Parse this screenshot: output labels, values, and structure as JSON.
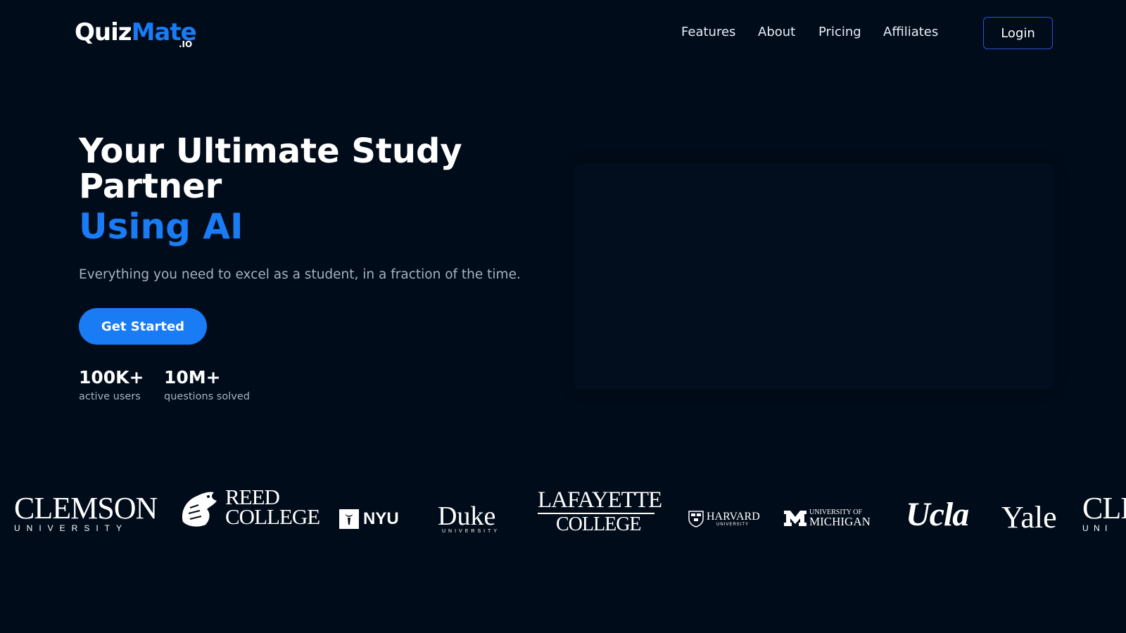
{
  "nav": {
    "logo_main": "Quiz",
    "logo_accent": "Mate",
    "logo_suffix": ".IO",
    "links": [
      "Features",
      "About",
      "Pricing",
      "Affiliates"
    ],
    "login_label": "Login"
  },
  "hero": {
    "title": "Your Ultimate Study Partner",
    "accent": "Using AI",
    "subtitle": "Everything you need to excel as a student, in a fraction of the time.",
    "cta_label": "Get Started",
    "stats": [
      {
        "value": "100K+",
        "label": "active users"
      },
      {
        "value": "10M+",
        "label": "questions solved"
      }
    ]
  },
  "universities": {
    "clemson": {
      "name": "CLEMSON",
      "sub": "UNIVERSITY"
    },
    "reed": {
      "line1": "REED",
      "line2": "COLLEGE"
    },
    "nyu": {
      "name": "NYU"
    },
    "duke": {
      "name": "Duke",
      "sub": "UNIVERSITY"
    },
    "lafayette": {
      "line1": "LAFAYETTE",
      "line2": "COLLEGE"
    },
    "harvard": {
      "name": "HARVARD",
      "sub": "UNIVERSITY"
    },
    "michigan": {
      "line1": "UNIVERSITY OF",
      "line2": "MICHIGAN"
    },
    "ucla": {
      "name": "Ucla"
    },
    "yale": {
      "name": "Yale"
    },
    "clemson_repeat": {
      "name": "CLE",
      "sub": "U N I"
    }
  },
  "colors": {
    "background": "#010c1a",
    "accent": "#1a7cf5",
    "muted_text": "#a7b1c0",
    "login_border": "#2d52d6"
  }
}
